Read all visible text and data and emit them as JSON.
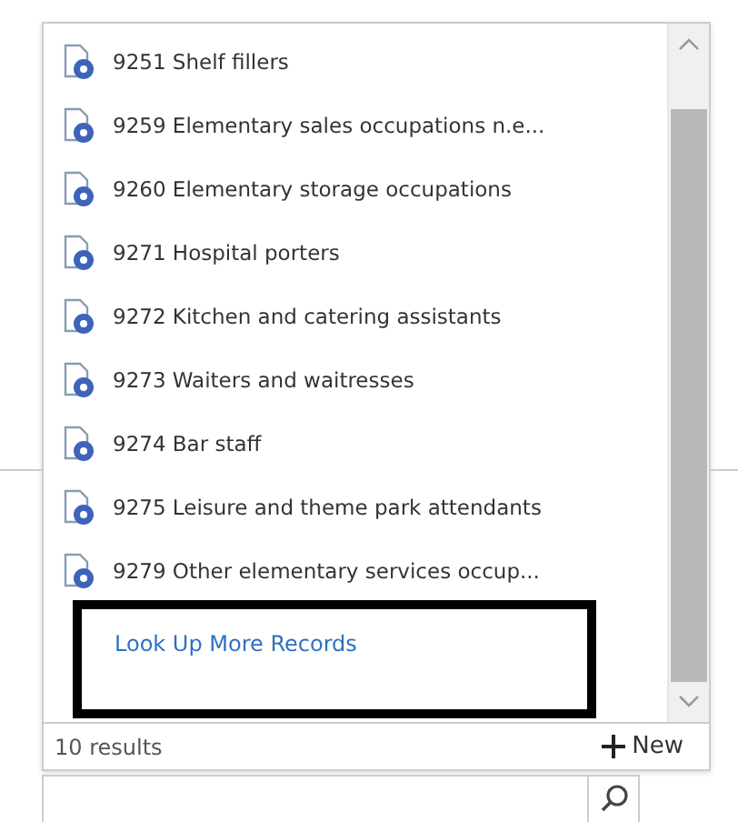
{
  "lookup_dropdown": {
    "results": [
      {
        "label": "9251 Shelf fillers"
      },
      {
        "label": "9259 Elementary sales occupations n.e..."
      },
      {
        "label": "9260 Elementary storage occupations"
      },
      {
        "label": "9271 Hospital porters"
      },
      {
        "label": "9272 Kitchen and catering assistants"
      },
      {
        "label": "9273 Waiters and waitresses"
      },
      {
        "label": "9274 Bar staff"
      },
      {
        "label": "9275 Leisure and theme park attendants"
      },
      {
        "label": "9279 Other elementary services occup..."
      }
    ],
    "more_link": "Look Up More Records",
    "result_count": "10 results",
    "new_button": "New"
  }
}
